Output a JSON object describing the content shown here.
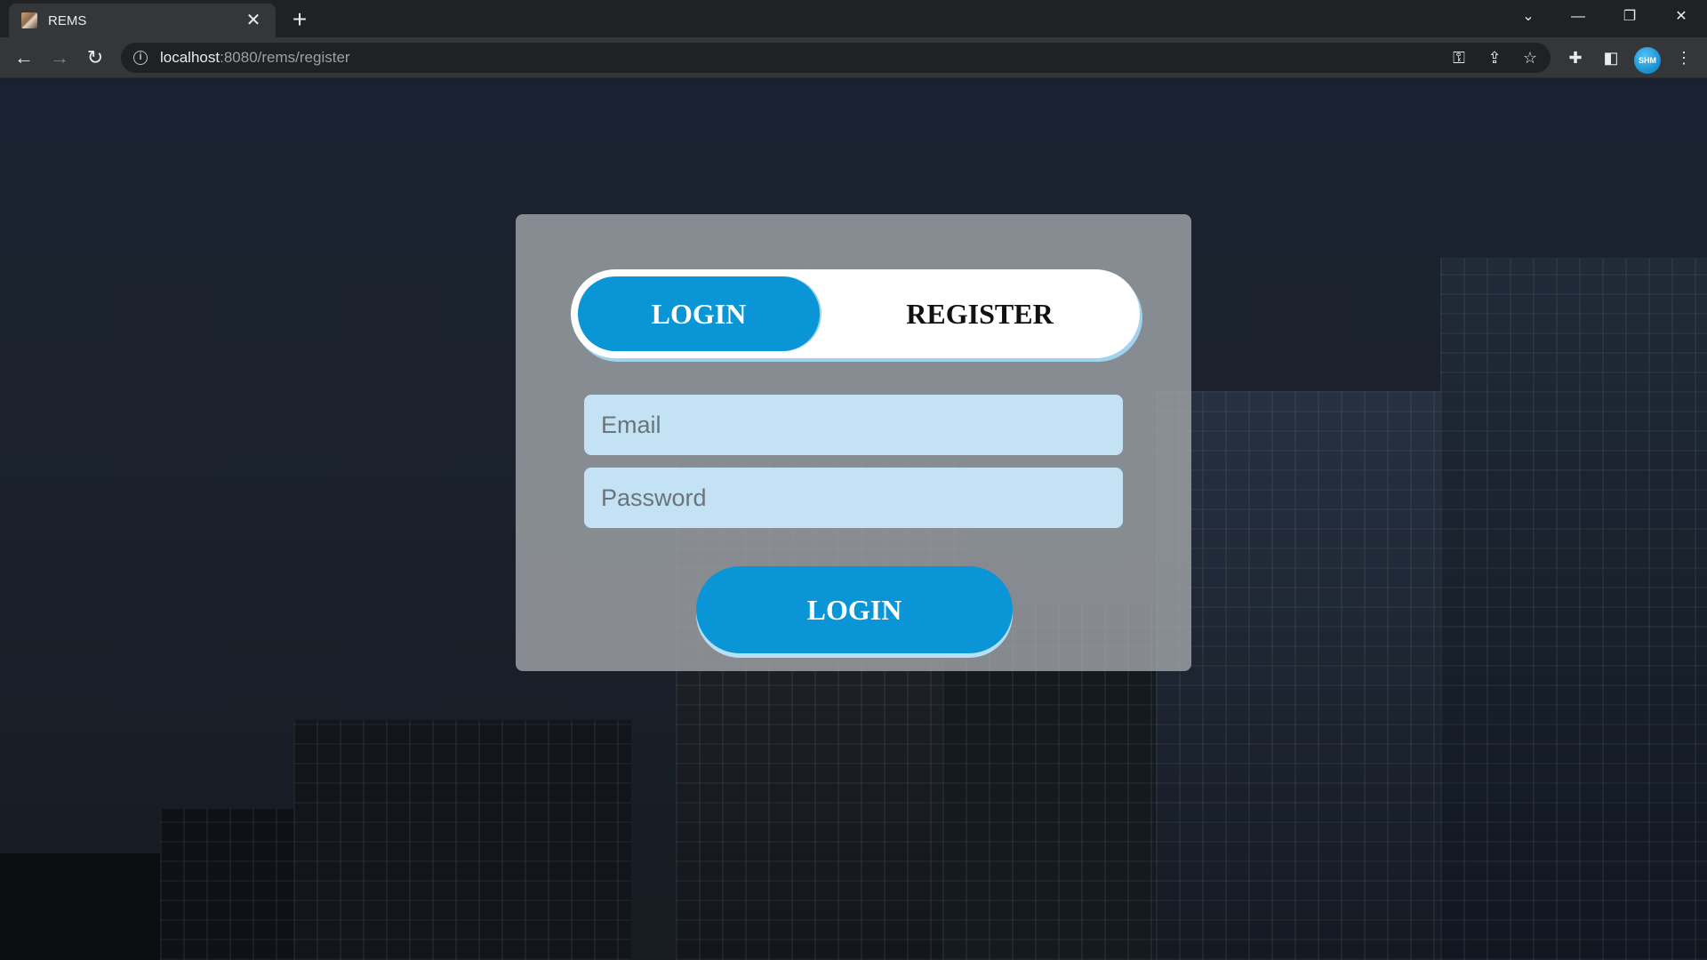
{
  "browser": {
    "tab_title": "REMS",
    "url_host": "localhost",
    "url_rest": ":8080/rems/register",
    "profile_label": "SHM"
  },
  "toggle": {
    "login_label": "LOGIN",
    "register_label": "REGISTER",
    "active": "login"
  },
  "form": {
    "email_placeholder": "Email",
    "email_value": "",
    "password_placeholder": "Password",
    "password_value": "",
    "submit_label": "LOGIN"
  },
  "colors": {
    "accent": "#0a96d6",
    "input_bg": "#c3e3f4",
    "card_bg": "#a0a3a8"
  },
  "icons": {
    "favicon": "rems-favicon-icon",
    "tab_close": "close-icon",
    "new_tab": "plus-icon",
    "back": "arrow-left-icon",
    "forward": "arrow-right-icon",
    "reload": "reload-icon",
    "site_info": "info-icon",
    "password_key": "key-icon",
    "share": "share-icon",
    "bookmark": "star-icon",
    "extensions": "puzzle-icon",
    "side_panel": "side-panel-icon",
    "menu": "kebab-menu-icon"
  }
}
